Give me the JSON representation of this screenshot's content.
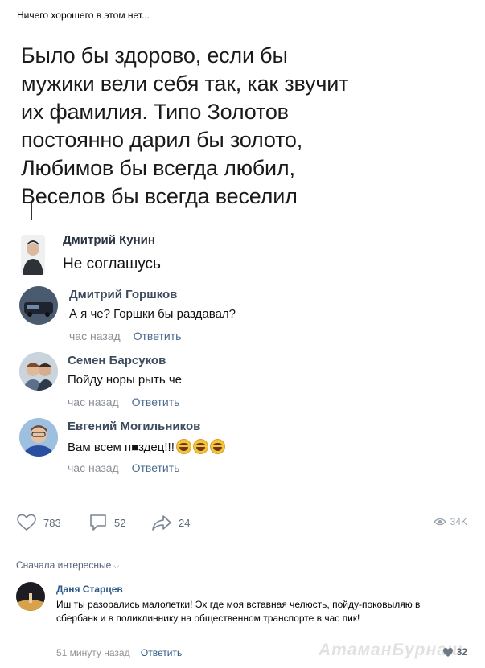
{
  "post": {
    "caption": "Ничего хорошего в этом нет..."
  },
  "meme": {
    "lines": [
      "Было бы здорово, если бы",
      "мужики вели себя так, как звучит",
      "их фамилия. Типо Золотов",
      "постоянно дарил бы золото,",
      "Любимов бы всегда любил,",
      "Веселов бы всегда веселил"
    ],
    "reply": {
      "name": "Дмитрий Кунин",
      "text": "Не соглашусь"
    },
    "comments": [
      {
        "name": "Дмитрий Горшков",
        "text": "А я че? Горшки бы раздавал?",
        "time": "час назад",
        "reply": "Ответить"
      },
      {
        "name": "Семен Барсуков",
        "text": "Пойду норы рыть че",
        "time": "час назад",
        "reply": "Ответить"
      },
      {
        "name": "Евгений Могильников",
        "text": "Вам всем п■здец!!!",
        "time": "час назад",
        "reply": "Ответить"
      }
    ]
  },
  "actions": {
    "likes": "783",
    "comments": "52",
    "shares": "24",
    "views": "34K"
  },
  "comments_section": {
    "sort_label": "Сначала интересные",
    "comment": {
      "name": "Даня Старцев",
      "text": "Иш ты разорались малолетки! Эх где моя вставная челюсть, пойду-поковыляю в сбербанк и в поликлиннику на общественном транспорте в час пик!",
      "time": "51 минуту назад",
      "reply": "Ответить",
      "likes": "32"
    }
  },
  "watermark": "АтаманБурнаш",
  "colors": {
    "link": "#2a5885",
    "meta": "#939393",
    "divider": "#e7e8ec"
  }
}
